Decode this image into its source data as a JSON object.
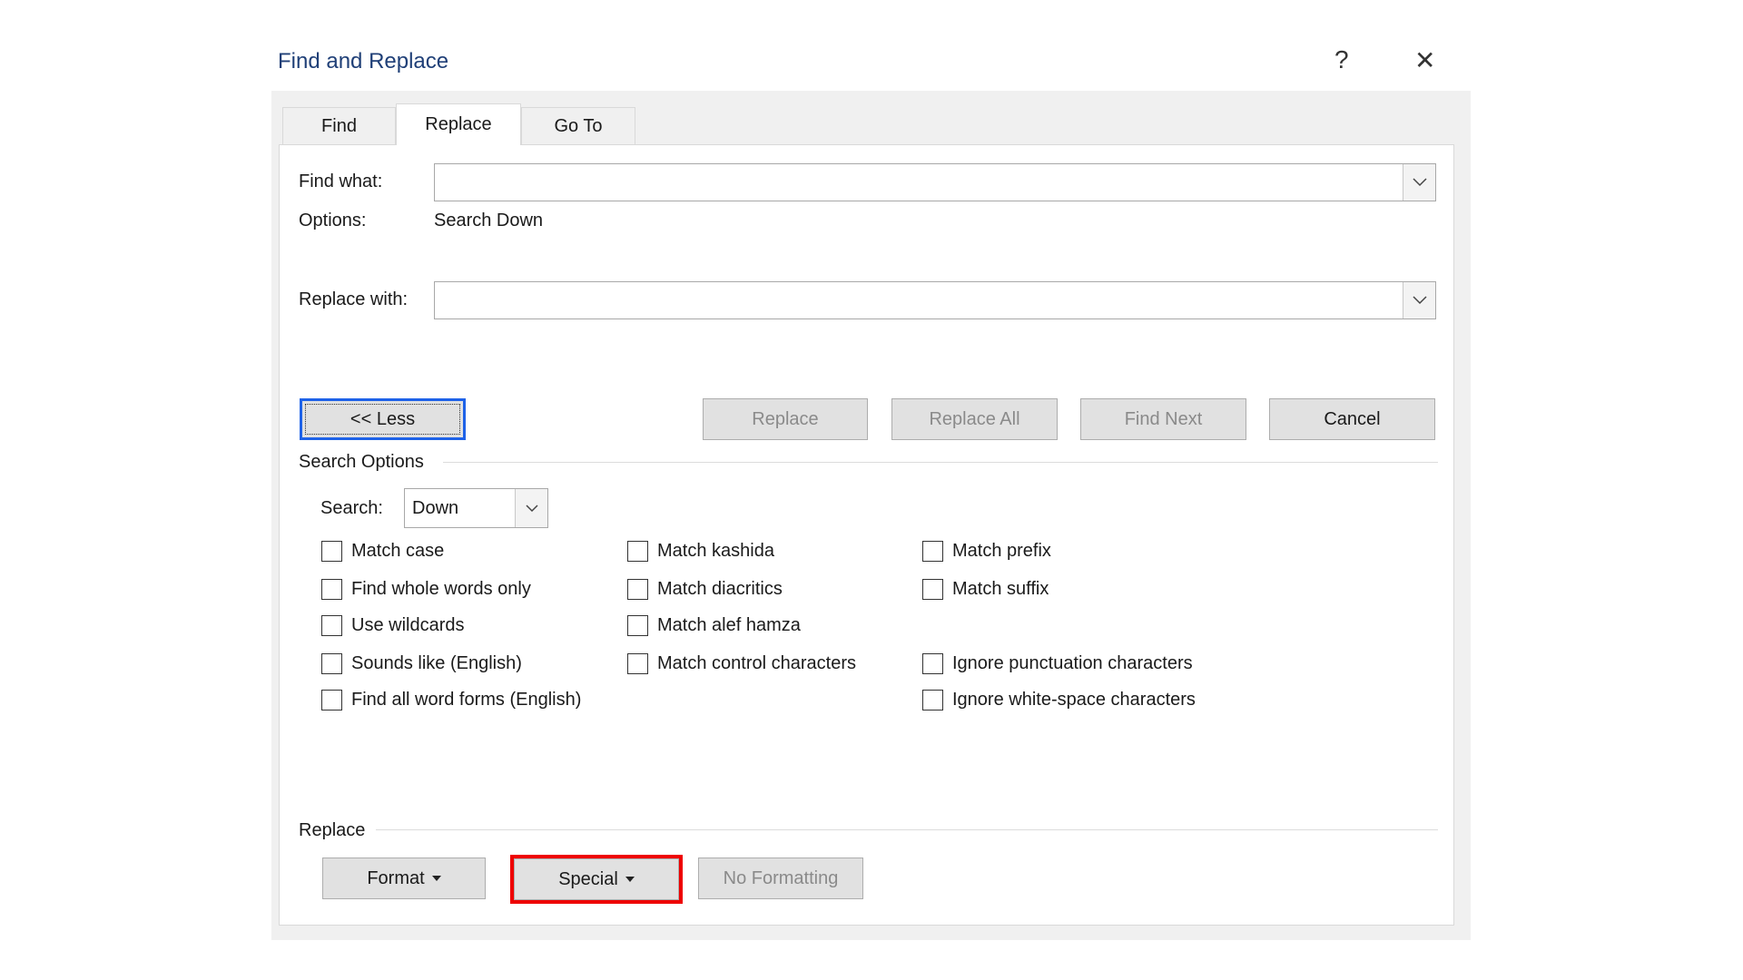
{
  "dialog": {
    "title": "Find and Replace",
    "help": "?",
    "close": "✕"
  },
  "tabs": [
    {
      "label": "Find"
    },
    {
      "label": "Replace",
      "active": true
    },
    {
      "label": "Go To"
    }
  ],
  "find": {
    "label": "Find what:",
    "value": "",
    "options_label": "Options:",
    "options_value": "Search Down"
  },
  "replace": {
    "label": "Replace with:",
    "value": ""
  },
  "buttons": {
    "less": "<< Less",
    "replace": "Replace",
    "replace_all": "Replace All",
    "find_next": "Find Next",
    "cancel": "Cancel"
  },
  "search_options": {
    "heading": "Search Options",
    "search_label": "Search:",
    "search_value": "Down"
  },
  "checkboxes": [
    {
      "label": "Match case",
      "checked": false
    },
    {
      "label": "Find whole words only",
      "checked": false
    },
    {
      "label": "Use wildcards",
      "checked": false
    },
    {
      "label": "Sounds like (English)",
      "checked": false
    },
    {
      "label": "Find all word forms (English)",
      "checked": false
    },
    {
      "label": "Match kashida",
      "checked": false
    },
    {
      "label": "Match diacritics",
      "checked": false
    },
    {
      "label": "Match alef hamza",
      "checked": false
    },
    {
      "label": "Match control characters",
      "checked": false
    },
    {
      "label": "Match prefix",
      "checked": false
    },
    {
      "label": "Match suffix",
      "checked": false
    },
    {
      "label": "Ignore punctuation characters",
      "checked": false
    },
    {
      "label": "Ignore white-space characters",
      "checked": false
    }
  ],
  "replace_section": {
    "heading": "Replace",
    "format": "Format",
    "special": "Special",
    "no_formatting": "No Formatting"
  },
  "colors": {
    "focus": "#1e62e8",
    "highlight": "#ee0000",
    "title": "#1f3f77"
  }
}
